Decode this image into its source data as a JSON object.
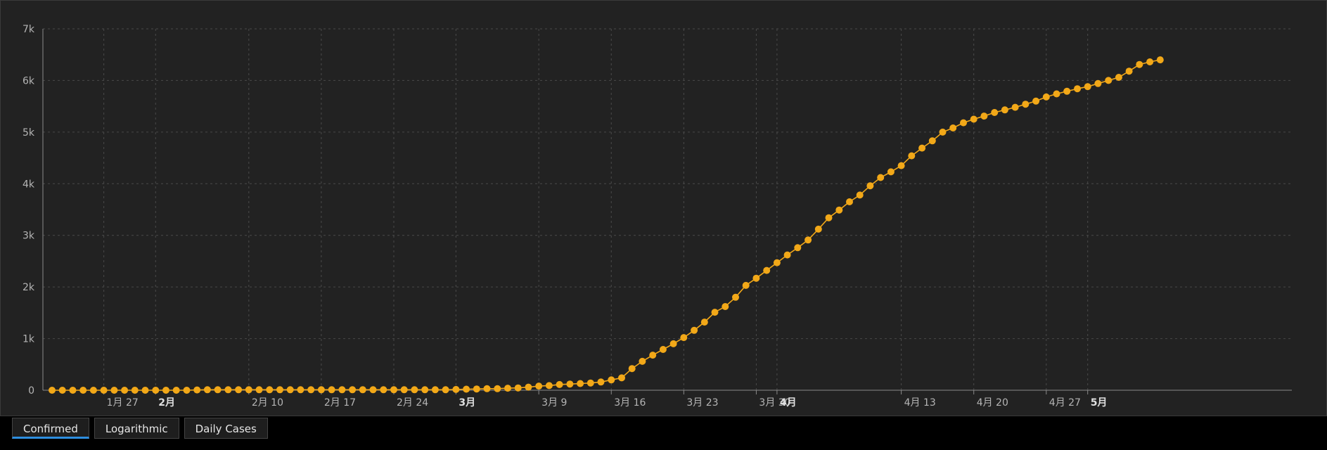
{
  "tabs": {
    "confirmed": "Confirmed",
    "logarithmic": "Logarithmic",
    "daily": "Daily Cases"
  },
  "colors": {
    "series": "#f2a818",
    "active_tab": "#2e8fe0"
  },
  "chart_data": {
    "type": "line",
    "title": "",
    "xlabel": "",
    "ylabel": "",
    "grid": true,
    "x_start_date": "2020-01-22",
    "x_ticks": [
      {
        "label": "1月 27",
        "date": "2020-01-27",
        "major": false
      },
      {
        "label": "2月",
        "date": "2020-02-01",
        "major": true
      },
      {
        "label": "2月 10",
        "date": "2020-02-10",
        "major": false
      },
      {
        "label": "2月 17",
        "date": "2020-02-17",
        "major": false
      },
      {
        "label": "2月 24",
        "date": "2020-02-24",
        "major": false
      },
      {
        "label": "3月",
        "date": "2020-03-01",
        "major": true
      },
      {
        "label": "3月 9",
        "date": "2020-03-09",
        "major": false
      },
      {
        "label": "3月 16",
        "date": "2020-03-16",
        "major": false
      },
      {
        "label": "3月 23",
        "date": "2020-03-23",
        "major": false
      },
      {
        "label": "3月 30",
        "date": "2020-03-30",
        "major": false
      },
      {
        "label": "4月",
        "date": "2020-04-01",
        "major": true
      },
      {
        "label": "4月 13",
        "date": "2020-04-13",
        "major": false
      },
      {
        "label": "4月 20",
        "date": "2020-04-20",
        "major": false
      },
      {
        "label": "4月 27",
        "date": "2020-04-27",
        "major": false
      },
      {
        "label": "5月",
        "date": "2020-05-01",
        "major": true
      }
    ],
    "y_ticks": [
      {
        "label": "0",
        "value": 0
      },
      {
        "label": "1k",
        "value": 1000
      },
      {
        "label": "2k",
        "value": 2000
      },
      {
        "label": "3k",
        "value": 3000
      },
      {
        "label": "4k",
        "value": 4000
      },
      {
        "label": "5k",
        "value": 5000
      },
      {
        "label": "6k",
        "value": 6000
      },
      {
        "label": "7k",
        "value": 7000
      }
    ],
    "ylim": [
      0,
      7000
    ],
    "series": [
      {
        "values": [
          0,
          0,
          0,
          0,
          0,
          0,
          0,
          0,
          0,
          0,
          0,
          0,
          0,
          0,
          5,
          10,
          10,
          10,
          10,
          10,
          10,
          10,
          10,
          10,
          10,
          10,
          10,
          10,
          10,
          10,
          10,
          10,
          10,
          10,
          10,
          10,
          10,
          10,
          10,
          15,
          20,
          25,
          30,
          30,
          40,
          45,
          60,
          80,
          90,
          110,
          120,
          130,
          140,
          160,
          200,
          240,
          420,
          560,
          680,
          790,
          900,
          1020,
          1160,
          1320,
          1510,
          1620,
          1800,
          2030,
          2170,
          2320,
          2470,
          2620,
          2760,
          2910,
          3120,
          3340,
          3490,
          3650,
          3780,
          3960,
          4120,
          4230,
          4350,
          4540,
          4690,
          4830,
          5000,
          5080,
          5180,
          5250,
          5310,
          5380,
          5430,
          5480,
          5540,
          5600,
          5680,
          5740,
          5790,
          5840,
          5880,
          5940,
          6000,
          6060,
          6180,
          6310,
          6360,
          6400
        ]
      }
    ]
  }
}
